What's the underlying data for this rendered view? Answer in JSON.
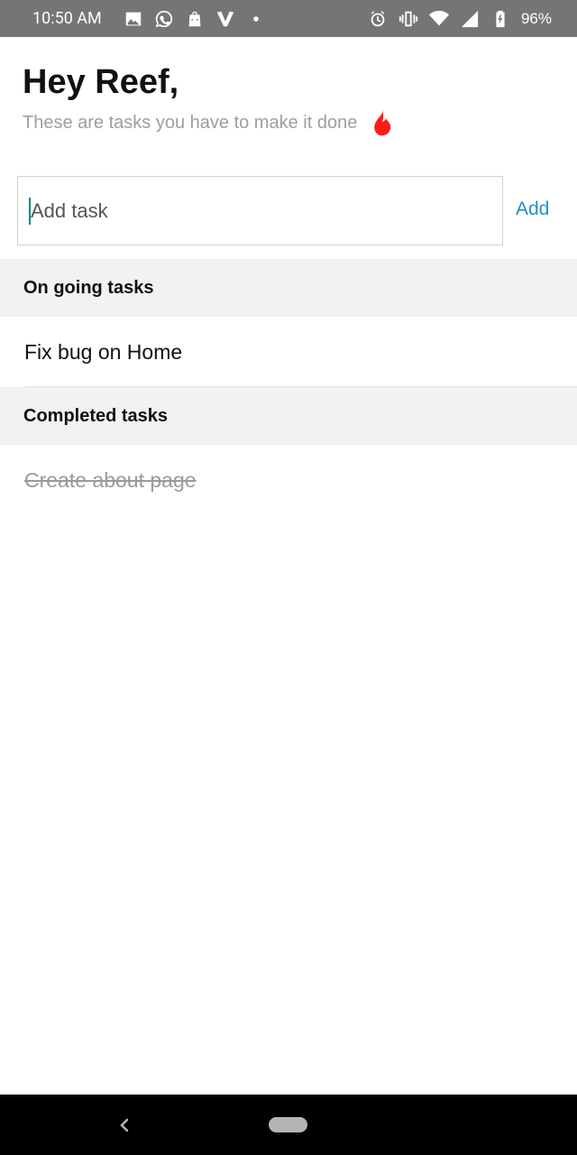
{
  "status_bar": {
    "time": "10:50 AM",
    "battery": "96%",
    "icons_left": [
      "image-icon",
      "whatsapp-icon",
      "shopping-bag-icon",
      "v-logo-icon",
      "dot-icon"
    ],
    "icons_right": [
      "alarm-icon",
      "vibrate-icon",
      "wifi-icon",
      "signal-icon",
      "battery-icon"
    ]
  },
  "header": {
    "greeting": "Hey Reef,",
    "subtitle": "These are tasks you have to make it done",
    "emoji_icon": "fire-icon"
  },
  "task_input": {
    "placeholder": "Add task",
    "value": "",
    "add_label": "Add"
  },
  "sections": {
    "ongoing_title": "On going tasks",
    "completed_title": "Completed tasks"
  },
  "tasks": {
    "ongoing": [
      "Fix bug on Home"
    ],
    "completed": [
      "Create about page"
    ]
  },
  "colors": {
    "status_bar_bg": "#757575",
    "accent_add": "#1e90c8",
    "section_bg": "#f2f2f2",
    "fire": "#ff1a1a",
    "caret": "#00897b"
  }
}
